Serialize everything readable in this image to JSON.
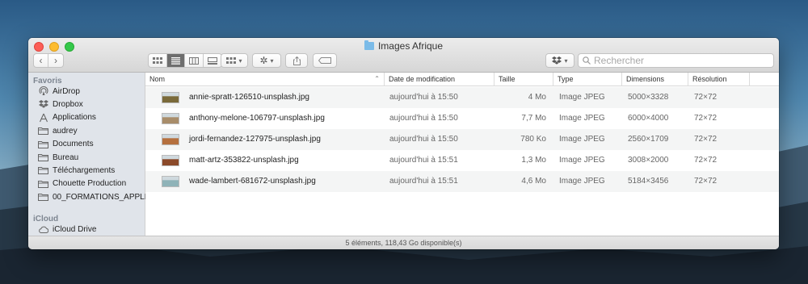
{
  "window": {
    "title": "Images Afrique"
  },
  "toolbar": {
    "search_placeholder": "Rechercher",
    "icons": [
      "back-chevron",
      "forward-chevron",
      "icon-view",
      "list-view",
      "column-view",
      "gallery-view",
      "group-menu",
      "action-gear-menu",
      "share",
      "tag",
      "dropbox-menu",
      "search"
    ]
  },
  "sidebar": {
    "favorites_label": "Favoris",
    "favorites": [
      {
        "label": "AirDrop",
        "icon": "airdrop-icon"
      },
      {
        "label": "Dropbox",
        "icon": "dropbox-icon"
      },
      {
        "label": "Applications",
        "icon": "applications-icon"
      },
      {
        "label": "audrey",
        "icon": "folder-icon"
      },
      {
        "label": "Documents",
        "icon": "folder-icon"
      },
      {
        "label": "Bureau",
        "icon": "folder-icon"
      },
      {
        "label": "Téléchargements",
        "icon": "folder-icon"
      },
      {
        "label": "Chouette Production",
        "icon": "folder-icon"
      },
      {
        "label": "00_FORMATIONS_APPLE",
        "icon": "folder-icon"
      }
    ],
    "icloud_label": "iCloud",
    "icloud": [
      {
        "label": "iCloud Drive",
        "icon": "cloud-icon"
      }
    ]
  },
  "table": {
    "columns": [
      "Nom",
      "Date de modification",
      "Taille",
      "Type",
      "Dimensions",
      "Résolution"
    ],
    "rows": [
      {
        "name": "annie-spratt-126510-unsplash.jpg",
        "date": "aujourd'hui à 15:50",
        "size": "4 Mo",
        "type": "Image JPEG",
        "dimensions": "5000×3328",
        "resolution": "72×72",
        "thumb_color": "#7a6a3a"
      },
      {
        "name": "anthony-melone-106797-unsplash.jpg",
        "date": "aujourd'hui à 15:50",
        "size": "7,7 Mo",
        "type": "Image JPEG",
        "dimensions": "6000×4000",
        "resolution": "72×72",
        "thumb_color": "#a88d6a"
      },
      {
        "name": "jordi-fernandez-127975-unsplash.jpg",
        "date": "aujourd'hui à 15:50",
        "size": "780 Ko",
        "type": "Image JPEG",
        "dimensions": "2560×1709",
        "resolution": "72×72",
        "thumb_color": "#b5703e"
      },
      {
        "name": "matt-artz-353822-unsplash.jpg",
        "date": "aujourd'hui à 15:51",
        "size": "1,3 Mo",
        "type": "Image JPEG",
        "dimensions": "3008×2000",
        "resolution": "72×72",
        "thumb_color": "#8b4a2a"
      },
      {
        "name": "wade-lambert-681672-unsplash.jpg",
        "date": "aujourd'hui à 15:51",
        "size": "4,6 Mo",
        "type": "Image JPEG",
        "dimensions": "5184×3456",
        "resolution": "72×72",
        "thumb_color": "#8fb3b8"
      }
    ]
  },
  "status": {
    "text": "5 éléments, 118,43 Go disponible(s)"
  }
}
